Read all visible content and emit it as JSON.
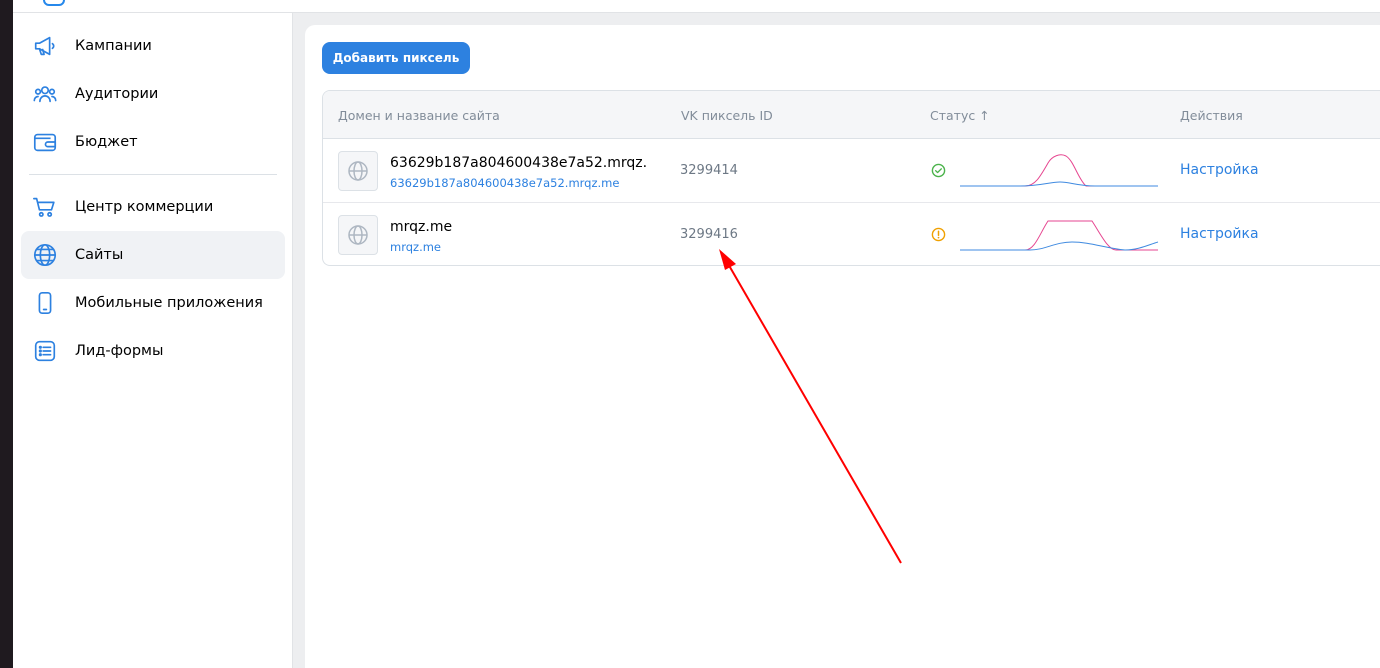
{
  "sidebar": {
    "items": [
      {
        "label": "Кампании",
        "icon": "megaphone-icon"
      },
      {
        "label": "Аудитории",
        "icon": "users-icon"
      },
      {
        "label": "Бюджет",
        "icon": "wallet-icon"
      },
      {
        "label": "Центр коммерции",
        "icon": "cart-icon"
      },
      {
        "label": "Сайты",
        "icon": "globe-icon",
        "active": true
      },
      {
        "label": "Мобильные приложения",
        "icon": "phone-icon"
      },
      {
        "label": "Лид-формы",
        "icon": "list-icon"
      }
    ]
  },
  "main": {
    "add_button_label": "Добавить пиксель",
    "columns": [
      "Домен и название сайта",
      "VK пиксель ID",
      "Статус ↑",
      "Действия"
    ],
    "rows": [
      {
        "site_name": "63629b187a804600438e7a52.mrqz.",
        "site_domain": "63629b187a804600438e7a52.mrqz.me",
        "pixel_id": "3299414",
        "status": "ok",
        "action": "Настройка"
      },
      {
        "site_name": "mrqz.me",
        "site_domain": "mrqz.me",
        "pixel_id": "3299416",
        "status": "warning",
        "action": "Настройка"
      }
    ]
  },
  "colors": {
    "accent": "#2d81e0",
    "status_ok": "#4bb34b",
    "status_warning": "#f0a000",
    "annotation_arrow": "#ff0000",
    "sparkline_pink": "#e64690",
    "sparkline_blue": "#3f8ae0"
  }
}
